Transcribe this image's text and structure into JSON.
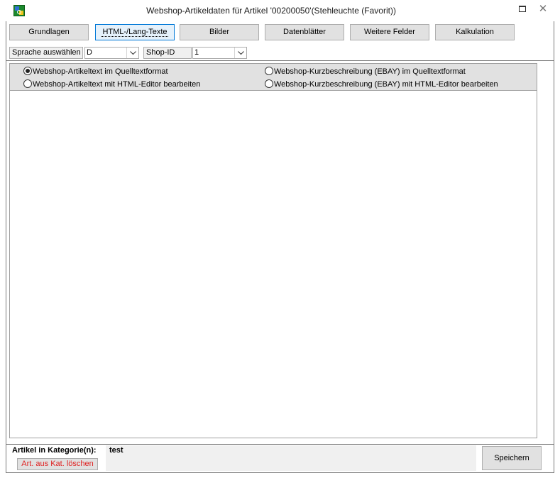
{
  "window": {
    "title": "Webshop-Artikeldaten für Artikel '00200050'(Stehleuchte  (Favorit))",
    "maximize_glyph": "",
    "close_glyph": "✕"
  },
  "tabs": [
    {
      "label": "Grundlagen",
      "active": false
    },
    {
      "label": "HTML-/Lang-Texte",
      "active": true
    },
    {
      "label": "Bilder",
      "active": false
    },
    {
      "label": "Datenblätter",
      "active": false
    },
    {
      "label": "Weitere Felder",
      "active": false
    },
    {
      "label": "Kalkulation",
      "active": false
    }
  ],
  "language": {
    "label": "Sprache auswählen",
    "value": "D"
  },
  "shop": {
    "label": "Shop-ID",
    "value": "1"
  },
  "radio_options": [
    {
      "label": "Webshop-Artikeltext im Quelltextformat",
      "checked": true
    },
    {
      "label": "Webshop-Artikeltext mit HTML-Editor bearbeiten",
      "checked": false
    },
    {
      "label": "Webshop-Kurzbeschreibung (EBAY) im Quelltextformat",
      "checked": false
    },
    {
      "label": "Webshop-Kurzbeschreibung (EBAY) mit HTML-Editor bearbeiten",
      "checked": false
    }
  ],
  "category": {
    "label": "Artikel in Kategorie(n):",
    "value": "test",
    "remove_label": "Art. aus Kat. löschen"
  },
  "save_label": "Speichern",
  "colors": {
    "accent": "#0078d7",
    "delete_text": "#e02020",
    "button_face": "#e1e1e1"
  }
}
